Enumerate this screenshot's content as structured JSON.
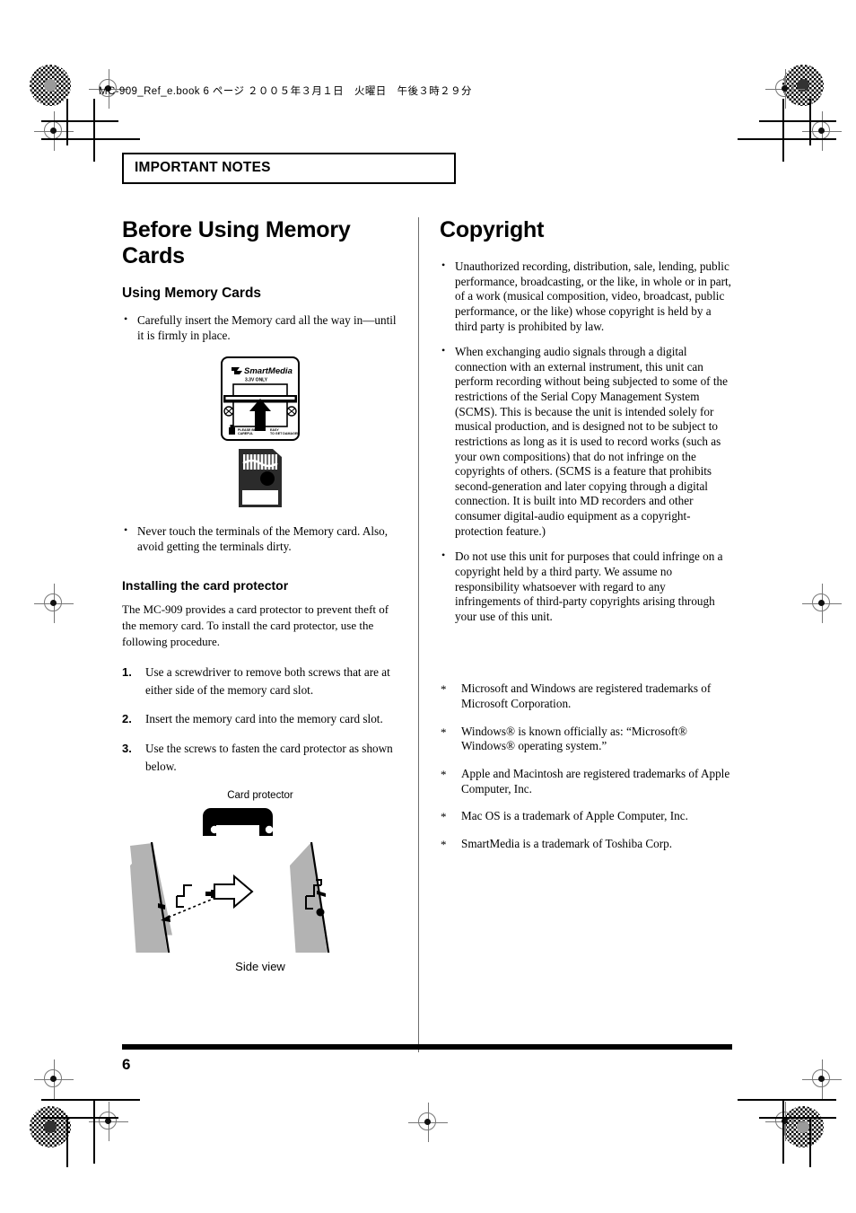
{
  "doc": {
    "header_line": "MC-909_Ref_e.book  6 ページ  ２００５年３月１日　火曜日　午後３時２９分",
    "banner": "IMPORTANT NOTES",
    "page_number": "6"
  },
  "left_column": {
    "title": "Before Using Memory Cards",
    "subtitle": "Using Memory Cards",
    "bullets": [
      "Carefully insert the Memory card all the way in—until it is firmly in place.",
      "Never touch the terminals of the Memory card. Also, avoid getting the terminals dirty."
    ],
    "card_figure": {
      "brand_label": "SmartMedia",
      "voltage_label": "3.3V ONLY",
      "slot_left_label": "PLEASE BE CAREFUL",
      "slot_right_label": "EASY TO GET DAMAGED"
    },
    "installing": {
      "heading": "Installing the card protector",
      "intro": "The MC-909 provides a card protector to prevent theft of the memory card. To install the card protector, use the following procedure.",
      "steps": [
        {
          "num": "1.",
          "text": "Use a screwdriver to remove both screws that are at either side of the memory card slot."
        },
        {
          "num": "2.",
          "text": "Insert the memory card into the memory card slot."
        },
        {
          "num": "3.",
          "text": "Use the screws to fasten the card protector as shown below."
        }
      ]
    },
    "side_view_figure": {
      "top_caption": "Card protector",
      "bottom_caption": "Side view"
    }
  },
  "right_column": {
    "title": "Copyright",
    "bullets": [
      "Unauthorized recording, distribution, sale, lending, public performance, broadcasting, or the like, in whole or in part, of a work (musical composition, video, broadcast, public performance, or the like) whose copyright is held by a third party is prohibited by law.",
      "When exchanging audio signals through a digital connection with an external instrument, this unit can perform recording without being subjected to some of the restrictions of the Serial Copy Management System (SCMS). This is because the unit is intended solely for musical production, and is designed not to be subject to restrictions as long as it is used to record works (such as your own compositions) that do not infringe on the copyrights of others. (SCMS is a feature that prohibits second-generation and later copying through a digital connection. It is built into MD recorders and other consumer digital-audio equipment as a copyright-protection feature.)",
      "Do not use this unit for purposes that could infringe on a copyright held by a third party. We assume no responsibility whatsoever with regard to any infringements of third-party copyrights arising through your use of this unit."
    ],
    "trademarks": [
      "Microsoft and Windows are registered trademarks of Microsoft Corporation.",
      "Windows® is known officially as: “Microsoft® Windows® operating system.”",
      "Apple and Macintosh are registered trademarks of Apple Computer, Inc.",
      "Mac OS is a trademark of Apple Computer, Inc.",
      "SmartMedia is a trademark of Toshiba Corp."
    ]
  },
  "colors": {
    "text": "#000000",
    "rule": "#000000",
    "divider": "#6e6e6e",
    "figure_gray": "#b3b3b3"
  }
}
